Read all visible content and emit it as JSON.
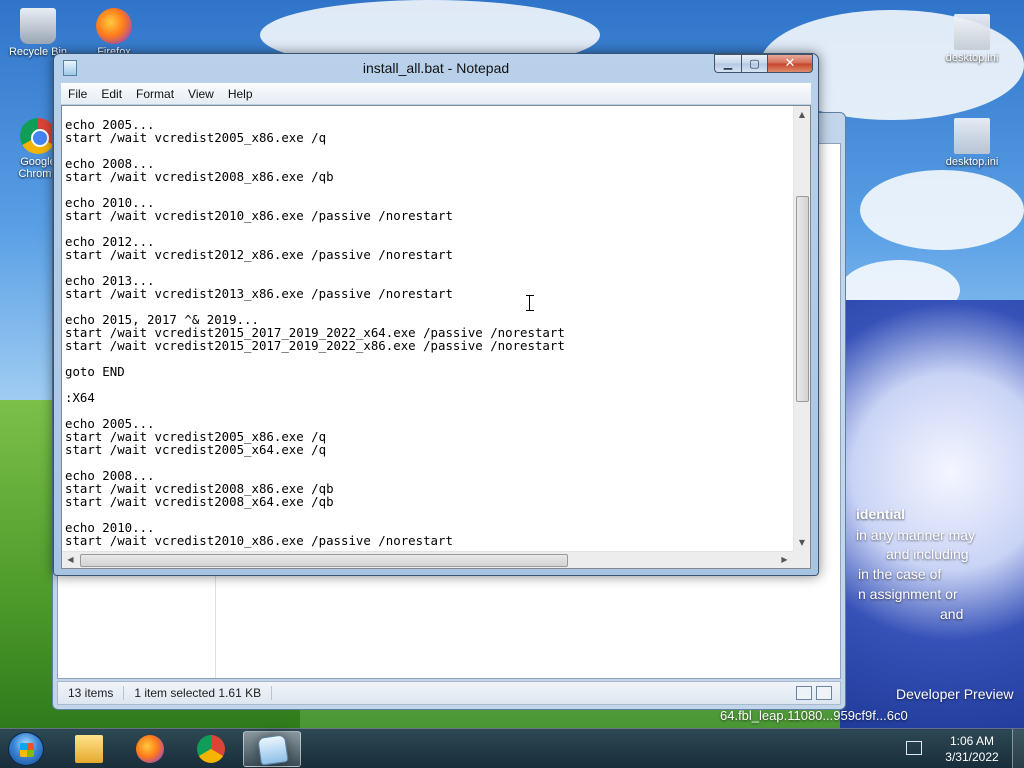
{
  "desktop": {
    "icons": [
      {
        "label": "Recycle Bin",
        "icon": "recycle-bin-icon"
      },
      {
        "label": "Firefox",
        "icon": "firefox-icon"
      },
      {
        "label": "Google Chrome",
        "icon": "chrome-icon"
      },
      {
        "label": "desktop.ini",
        "icon": "ini-file-icon"
      },
      {
        "label": "desktop.ini",
        "icon": "ini-file-icon"
      }
    ],
    "overlay": {
      "line1": "idential",
      "line2": "in any manner may",
      "line3": "and including",
      "line4": "in the case of",
      "line5": "n assignment or",
      "line6": "and",
      "line7": "Developer Preview",
      "line8": "64.fbl_leap.11080...959cf9f...6c0"
    }
  },
  "explorer": {
    "status": {
      "items": "13 items",
      "selected": "1 item selected  1.61 KB"
    }
  },
  "notepad": {
    "title": "install_all.bat - Notepad",
    "menu": [
      "File",
      "Edit",
      "Format",
      "View",
      "Help"
    ],
    "lines": [
      "echo 2005...",
      "start /wait vcredist2005_x86.exe /q",
      "",
      "echo 2008...",
      "start /wait vcredist2008_x86.exe /qb",
      "",
      "echo 2010...",
      "start /wait vcredist2010_x86.exe /passive /norestart",
      "",
      "echo 2012...",
      "start /wait vcredist2012_x86.exe /passive /norestart",
      "",
      "echo 2013...",
      "start /wait vcredist2013_x86.exe /passive /norestart",
      "",
      "echo 2015, 2017 ^& 2019...",
      "start /wait vcredist2015_2017_2019_2022_x64.exe /passive /norestart",
      "start /wait vcredist2015_2017_2019_2022_x86.exe /passive /norestart",
      "",
      "goto END",
      "",
      ":X64",
      "",
      "echo 2005...",
      "start /wait vcredist2005_x86.exe /q",
      "start /wait vcredist2005_x64.exe /q",
      "",
      "echo 2008...",
      "start /wait vcredist2008_x86.exe /qb",
      "start /wait vcredist2008_x64.exe /qb",
      "",
      "echo 2010...",
      "start /wait vcredist2010_x86.exe /passive /norestart"
    ]
  },
  "taskbar": {
    "clock_time": "1:06 AM",
    "clock_date": "3/31/2022",
    "buttons": [
      "Windows Explorer",
      "Firefox",
      "Google Chrome",
      "Notepad"
    ]
  }
}
